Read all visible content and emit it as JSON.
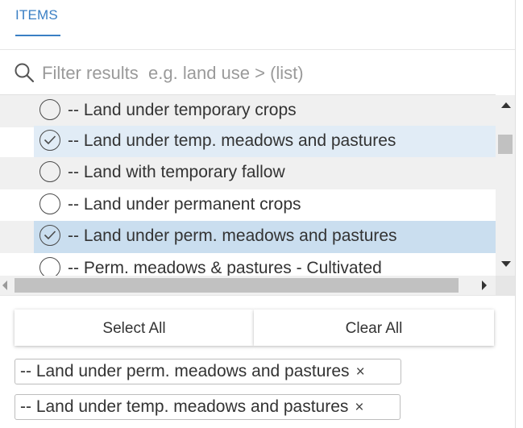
{
  "tab": {
    "label": "ITEMS"
  },
  "search": {
    "placeholder": "Filter results  e.g. land use > (list)",
    "value": ""
  },
  "list": {
    "items": [
      {
        "label": "-- Land under temporary crops",
        "selected": false
      },
      {
        "label": "-- Land under temp. meadows and pastures",
        "selected": true
      },
      {
        "label": "-- Land with temporary fallow",
        "selected": false
      },
      {
        "label": "-- Land under permanent crops",
        "selected": false
      },
      {
        "label": "-- Land under perm. meadows and pastures",
        "selected": true
      },
      {
        "label": "-- Perm. meadows & pastures - Cultivated",
        "selected": false
      }
    ]
  },
  "buttons": {
    "select_all": "Select All",
    "clear_all": "Clear All"
  },
  "chips": [
    {
      "label": "-- Land under perm. meadows and pastures",
      "remove": "×"
    },
    {
      "label": "-- Land under temp. meadows and pastures",
      "remove": "×"
    }
  ],
  "colors": {
    "accent": "#3a7fc4",
    "row_alt_bg": "#f0f0f0",
    "selected_bg_light": "#e1ecf6",
    "selected_bg_active": "#cadeef"
  }
}
